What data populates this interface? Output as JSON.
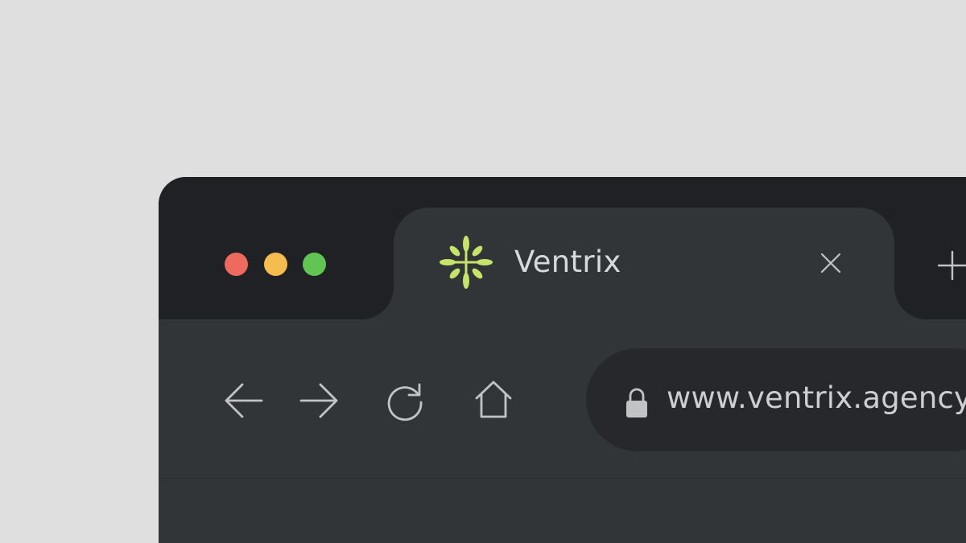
{
  "window": {
    "controls": {
      "close_color": "#ee6a5f",
      "minimize_color": "#f5bd4f",
      "zoom_color": "#61c554"
    }
  },
  "tab": {
    "title": "Ventrix",
    "favicon_icon": "ventrix-logo-icon",
    "favicon_color": "#c6e36a",
    "close_icon": "close-icon"
  },
  "new_tab": {
    "icon": "plus-icon"
  },
  "toolbar": {
    "back_icon": "arrow-left-icon",
    "forward_icon": "arrow-right-icon",
    "reload_icon": "reload-icon",
    "home_icon": "home-icon"
  },
  "address_bar": {
    "lock_icon": "lock-icon",
    "url": "www.ventrix.agency"
  },
  "colors": {
    "page_background": "#dfdfdf",
    "tabbar_background": "#202124",
    "toolbar_background": "#323538",
    "omnibox_background": "#26282b"
  }
}
